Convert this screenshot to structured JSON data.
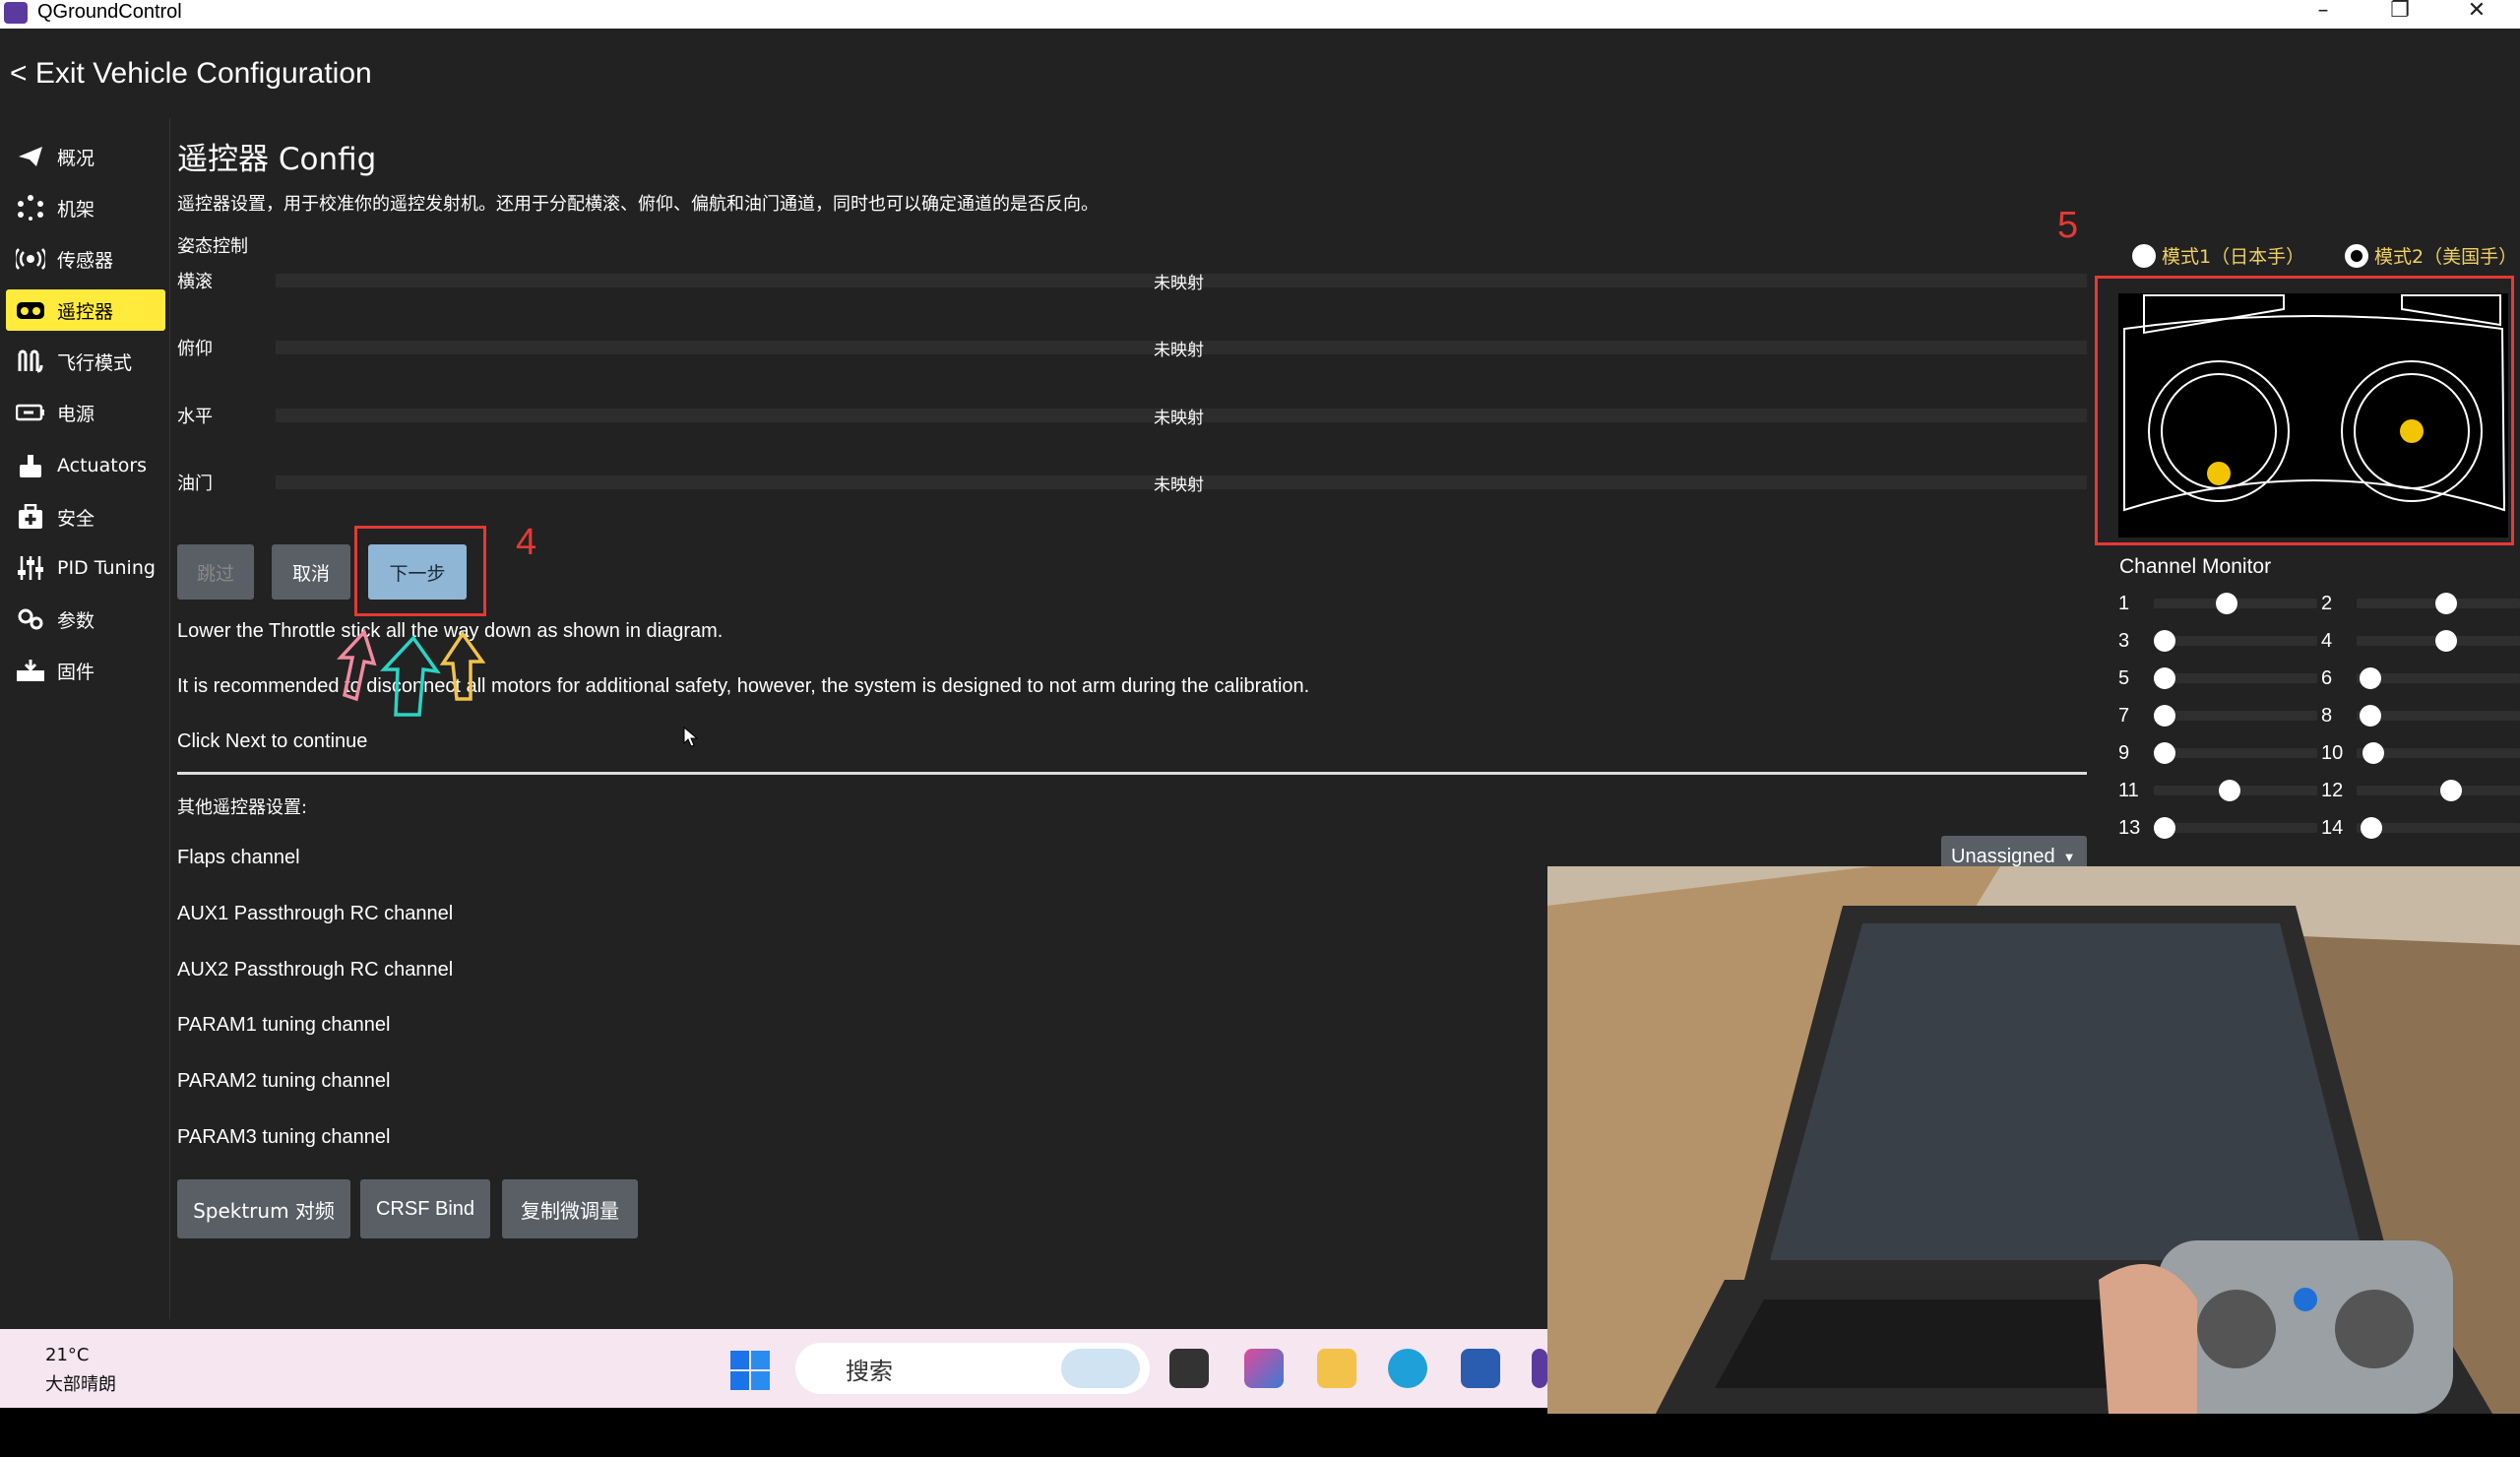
{
  "window": {
    "title": "QGroundControl",
    "minimize": "–",
    "restore": "❐",
    "close": "✕"
  },
  "header": {
    "exit_label": "< Exit Vehicle Configuration"
  },
  "sidebar": {
    "items": [
      {
        "label": "概况",
        "icon": "paper-plane-icon",
        "active": false
      },
      {
        "label": "机架",
        "icon": "airframe-icon",
        "active": false
      },
      {
        "label": "传感器",
        "icon": "sensors-icon",
        "active": false
      },
      {
        "label": "遥控器",
        "icon": "radio-controller-icon",
        "active": true
      },
      {
        "label": "飞行模式",
        "icon": "flight-modes-icon",
        "active": false
      },
      {
        "label": "电源",
        "icon": "battery-icon",
        "active": false
      },
      {
        "label": "Actuators",
        "icon": "actuators-icon",
        "active": false
      },
      {
        "label": "安全",
        "icon": "safety-icon",
        "active": false
      },
      {
        "label": "PID Tuning",
        "icon": "sliders-icon",
        "active": false
      },
      {
        "label": "参数",
        "icon": "parameters-icon",
        "active": false
      },
      {
        "label": "固件",
        "icon": "firmware-icon",
        "active": false
      }
    ]
  },
  "main": {
    "title": "遥控器 Config",
    "description": "遥控器设置，用于校准你的遥控发射机。还用于分配横滚、俯仰、偏航和油门通道，同时也可以确定通道的是否反向。",
    "section_attitude": "姿态控制",
    "attitude_rows": [
      {
        "label": "横滚",
        "status": "未映射"
      },
      {
        "label": "俯仰",
        "status": "未映射"
      },
      {
        "label": "水平",
        "status": "未映射"
      },
      {
        "label": "油门",
        "status": "未映射"
      }
    ],
    "buttons": {
      "skip": "跳过",
      "cancel": "取消",
      "next": "下一步"
    },
    "annotation_4": "4",
    "annotation_5": "5",
    "instructions": [
      "Lower the Throttle stick all the way down as shown in diagram.",
      "It is recommended to disconnect all motors for additional safety, however, the system is designed to not arm during the calibration.",
      "Click Next to continue"
    ],
    "other_title": "其他遥控器设置:",
    "other_rows": [
      "Flaps channel",
      "AUX1 Passthrough RC channel",
      "AUX2 Passthrough RC channel",
      "PARAM1 tuning channel",
      "PARAM2 tuning channel",
      "PARAM3 tuning channel"
    ],
    "flaps_dropdown": "Unassigned",
    "bottom_buttons": {
      "spektrum": "Spektrum 对频",
      "crsf": "CRSF Bind",
      "copy_trims": "复制微调量"
    }
  },
  "modes": {
    "mode1": "模式1（日本手）",
    "mode2": "模式2（美国手）",
    "selected": "mode2"
  },
  "channel_monitor": {
    "title": "Channel Monitor",
    "channels": [
      {
        "n": "1",
        "level": 0.43
      },
      {
        "n": "2",
        "level": 0.55
      },
      {
        "n": "3",
        "level": 0.0
      },
      {
        "n": "4",
        "level": 0.55
      },
      {
        "n": "5",
        "level": 0.0
      },
      {
        "n": "6",
        "level": 0.02
      },
      {
        "n": "7",
        "level": 0.0
      },
      {
        "n": "8",
        "level": 0.02
      },
      {
        "n": "9",
        "level": 0.0
      },
      {
        "n": "10",
        "level": 0.04
      },
      {
        "n": "11",
        "level": 0.45
      },
      {
        "n": "12",
        "level": 0.58
      },
      {
        "n": "13",
        "level": 0.0
      },
      {
        "n": "14",
        "level": 0.03
      }
    ]
  },
  "taskbar": {
    "weather_temp": "21°C",
    "weather_desc": "大部晴朗",
    "search_placeholder": "搜索"
  },
  "colors": {
    "accent": "#ffeb3b",
    "annotation": "#e53935",
    "stick": "#f2c500",
    "next_button": "#8fb6d4"
  }
}
